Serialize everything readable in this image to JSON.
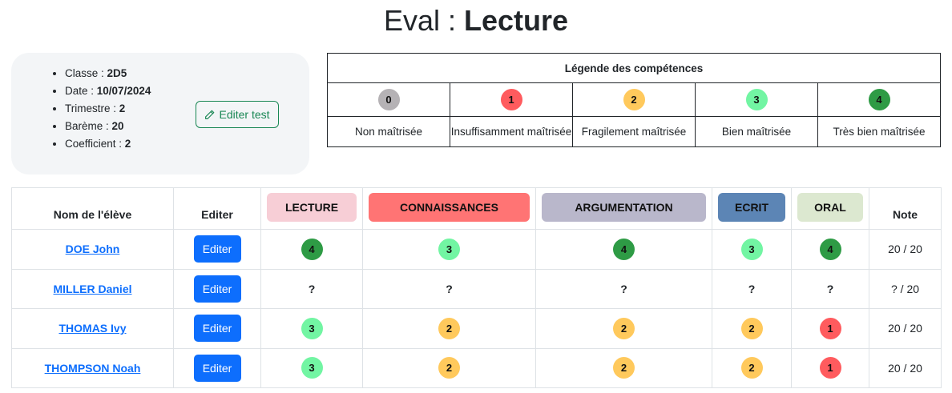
{
  "header": {
    "prefix": "Eval :",
    "name": "Lecture"
  },
  "info": {
    "items": [
      {
        "label": "Classe : ",
        "value": "2D5"
      },
      {
        "label": "Date : ",
        "value": "10/07/2024"
      },
      {
        "label": "Trimestre : ",
        "value": "2"
      },
      {
        "label": "Barème : ",
        "value": "20"
      },
      {
        "label": "Coefficient : ",
        "value": "2"
      }
    ],
    "edit_button": "Editer test"
  },
  "legend": {
    "title": "Légende des compétences",
    "levels": [
      {
        "value": "0",
        "label": "Non maîtrisée",
        "color": "#b5b2b5"
      },
      {
        "value": "1",
        "label": "Insuffisamment maîtrisée",
        "color": "#ff5b5e"
      },
      {
        "value": "2",
        "label": "Fragilement maîtrisée",
        "color": "#ffc95c"
      },
      {
        "value": "3",
        "label": "Bien maîtrisée",
        "color": "#72f5a3"
      },
      {
        "value": "4",
        "label": "Très bien maîtrisée",
        "color": "#2e9b45"
      }
    ]
  },
  "table": {
    "headers": {
      "name": "Nom de l'élève",
      "edit": "Editer",
      "note": "Note"
    },
    "competences": [
      {
        "label": "LECTURE",
        "color": "#f7ced6"
      },
      {
        "label": "CONNAISSANCES",
        "color": "#ff7474"
      },
      {
        "label": "ARGUMENTATION",
        "color": "#b9b7cb"
      },
      {
        "label": "ECRIT",
        "color": "#5c85b5"
      },
      {
        "label": "ORAL",
        "color": "#dce8d0"
      }
    ],
    "edit_label": "Editer",
    "rows": [
      {
        "name": "DOE John",
        "grades": [
          "4",
          "3",
          "4",
          "3",
          "4"
        ],
        "note": "20 / 20"
      },
      {
        "name": "MILLER Daniel",
        "grades": [
          "?",
          "?",
          "?",
          "?",
          "?"
        ],
        "note": "? / 20"
      },
      {
        "name": "THOMAS Ivy",
        "grades": [
          "3",
          "2",
          "2",
          "2",
          "1"
        ],
        "note": "20 / 20"
      },
      {
        "name": "THOMPSON Noah",
        "grades": [
          "3",
          "2",
          "2",
          "2",
          "1"
        ],
        "note": "20 / 20"
      }
    ]
  }
}
